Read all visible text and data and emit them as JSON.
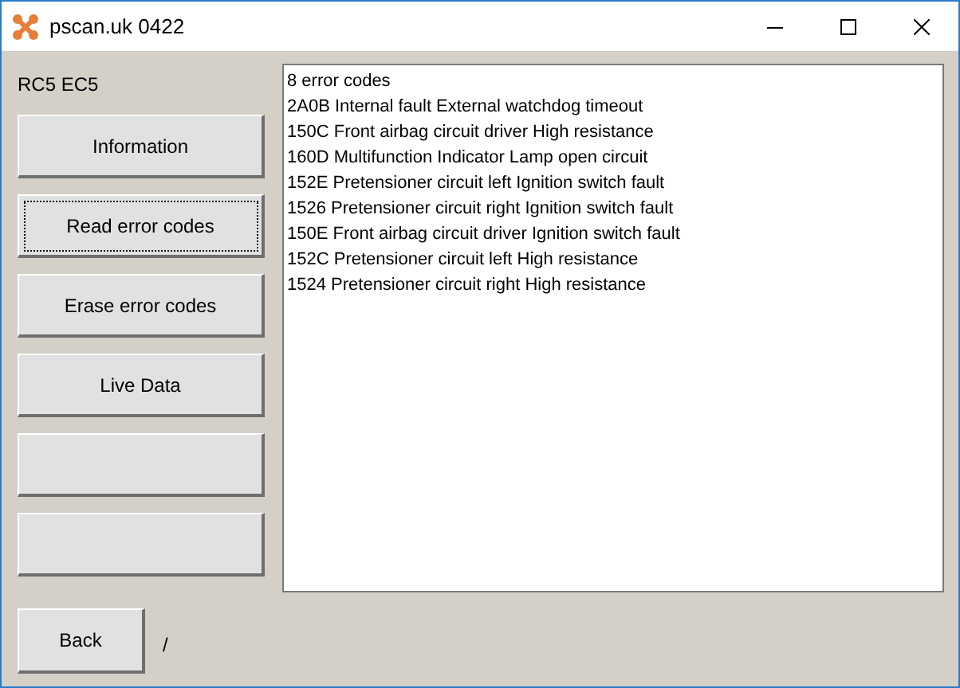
{
  "window": {
    "title": "pscan.uk 0422"
  },
  "module_label": "RC5 EC5",
  "buttons": [
    {
      "label": "Information",
      "focused": false
    },
    {
      "label": "Read error codes",
      "focused": true
    },
    {
      "label": "Erase error codes",
      "focused": false
    },
    {
      "label": "Live Data",
      "focused": false
    },
    {
      "focused": false
    },
    {
      "focused": false
    }
  ],
  "output_lines": [
    "8 error codes",
    "2A0B Internal fault External watchdog timeout",
    "150C Front airbag circuit driver High resistance",
    "160D Multifunction Indicator Lamp open circuit",
    "152E Pretensioner circuit left Ignition switch fault",
    "1526 Pretensioner circuit right Ignition switch fault",
    "150E Front airbag circuit driver Ignition switch fault",
    "152C Pretensioner circuit left High resistance",
    "1524 Pretensioner circuit right High resistance"
  ],
  "back_button": {
    "label": "Back"
  },
  "status_text": "/"
}
